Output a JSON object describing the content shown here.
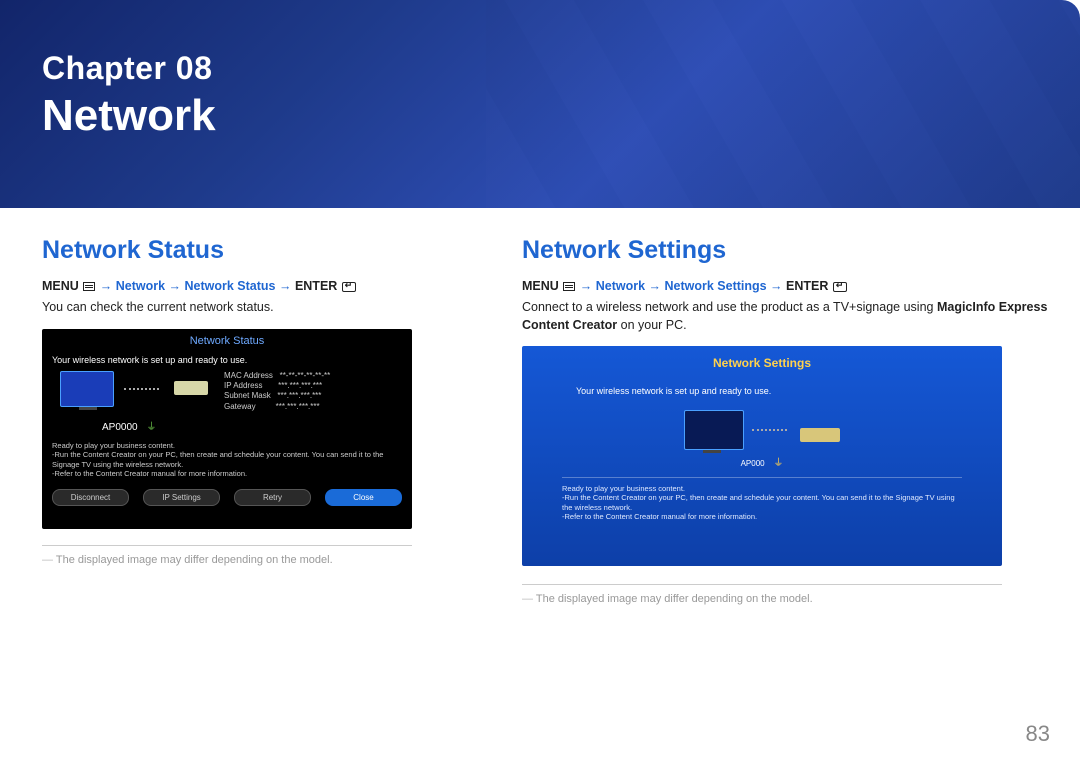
{
  "hero": {
    "chapter": "Chapter  08",
    "title": "Network"
  },
  "status": {
    "heading": "Network Status",
    "path_prefix": "MENU ",
    "path_mid": " → Network → Network Status → ",
    "path_suffix": "ENTER ",
    "desc": "You can check the current network status.",
    "shot": {
      "title": "Network Status",
      "msg": "Your wireless network is set up and ready to use.",
      "ap": "AP0000",
      "info": {
        "mac_label": "MAC Address",
        "mac_val": "**-**-**-**-**-**",
        "ip_label": "IP Address",
        "ip_val": "***.***.***.***",
        "sub_label": "Subnet Mask",
        "sub_val": "***.***.***.***",
        "gw_label": "Gateway",
        "gw_val": "***.***.***.***"
      },
      "ready1": "Ready to play your business content.",
      "ready2": "-Run the Content Creator on your PC, then create and schedule your content. You can send it to the Signage TV using the wireless network.",
      "ready3": "-Refer to the Content Creator manual for more information.",
      "buttons": [
        "Disconnect",
        "IP Settings",
        "Retry",
        "Close"
      ]
    },
    "note": "The displayed image may differ depending on the model."
  },
  "settings": {
    "heading": "Network Settings",
    "path_prefix": "MENU ",
    "path_mid": " → Network → Network Settings → ",
    "path_suffix": "ENTER ",
    "desc1": "Connect to a wireless network and use the product as a TV+signage using ",
    "desc_bold": "MagicInfo Express Content Creator",
    "desc2": " on your PC.",
    "shot": {
      "title": "Network Settings",
      "msg": "Your wireless network is set up and ready to use.",
      "ap": "AP000",
      "ready1": "Ready to play your business content.",
      "ready2": "-Run the Content Creator on your PC, then create and schedule your content. You can send it to the Signage TV using the wireless network.",
      "ready3": "-Refer to the Content Creator manual for more information."
    },
    "note": "The displayed image may differ depending on the model."
  },
  "page": "83"
}
